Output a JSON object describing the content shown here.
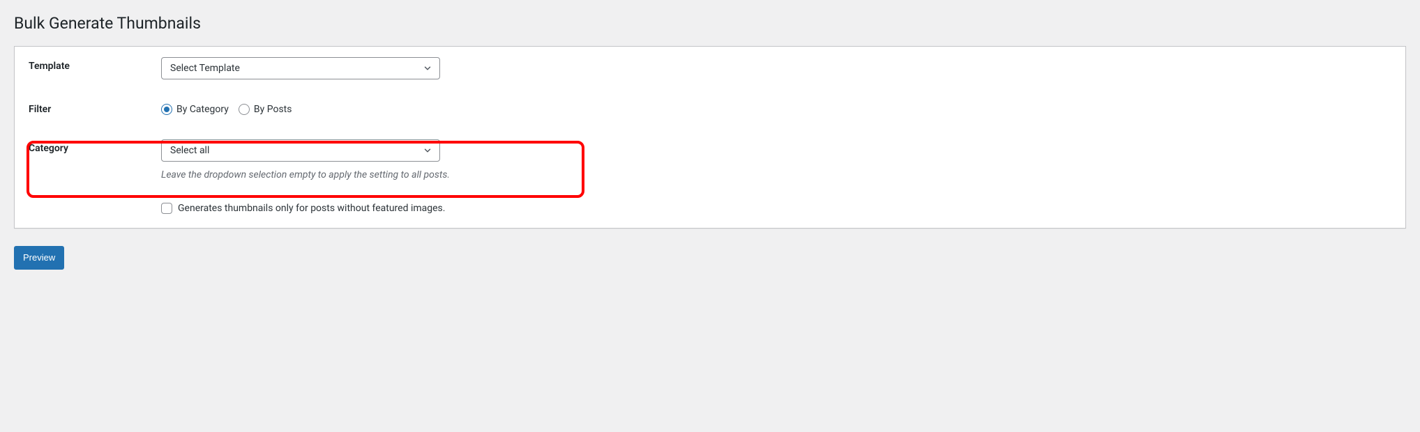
{
  "page": {
    "title": "Bulk Generate Thumbnails"
  },
  "fields": {
    "template": {
      "label": "Template",
      "selected": "Select Template"
    },
    "filter": {
      "label": "Filter",
      "options": {
        "by_category": "By Category",
        "by_posts": "By Posts"
      },
      "selected": "by_category"
    },
    "category": {
      "label": "Category",
      "selected": "Select all",
      "description": "Leave the dropdown selection empty to apply the setting to all posts."
    },
    "only_without_featured": {
      "label": "Generates thumbnails only for posts without featured images.",
      "checked": false
    }
  },
  "actions": {
    "preview": "Preview"
  }
}
